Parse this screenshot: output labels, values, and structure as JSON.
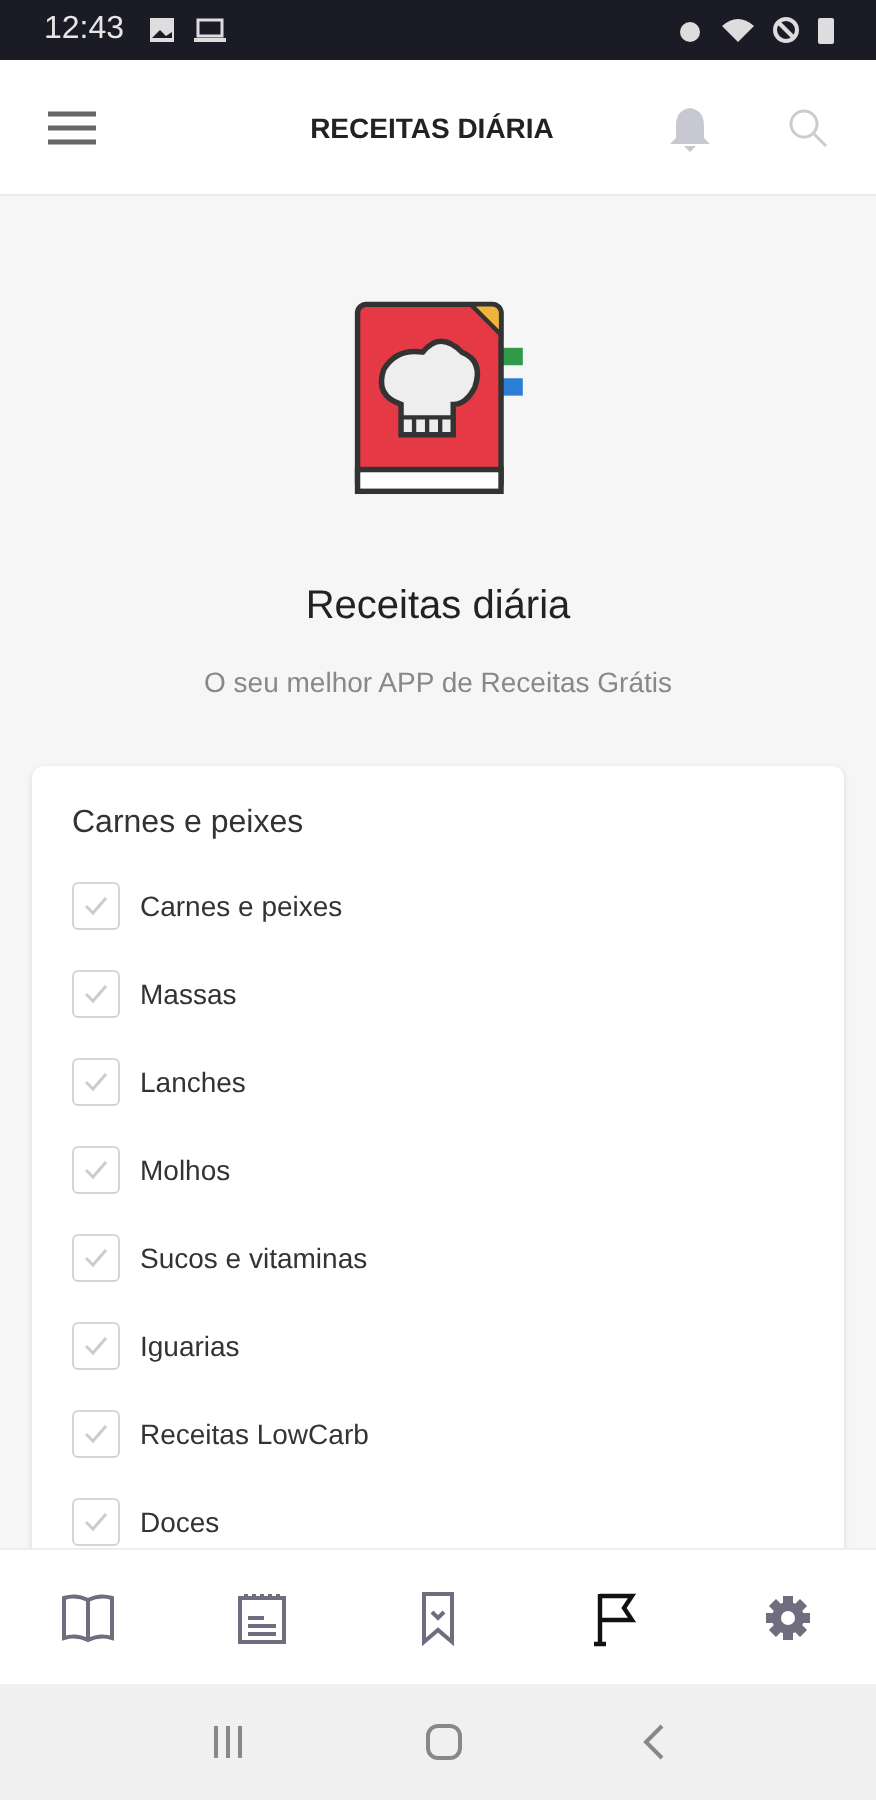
{
  "status_bar": {
    "time": "12:43"
  },
  "app_bar": {
    "title": "RECEITAS DIÁRIA"
  },
  "hero": {
    "title": "Receitas diária",
    "subtitle": "O seu melhor APP de Receitas Grátis"
  },
  "card": {
    "title": "Carnes e peixes",
    "items": [
      {
        "label": "Carnes e peixes",
        "checked": false
      },
      {
        "label": "Massas",
        "checked": false
      },
      {
        "label": "Lanches",
        "checked": false
      },
      {
        "label": "Molhos",
        "checked": false
      },
      {
        "label": "Sucos e vitaminas",
        "checked": false
      },
      {
        "label": "Iguarias",
        "checked": false
      },
      {
        "label": "Receitas LowCarb",
        "checked": false
      },
      {
        "label": "Doces",
        "checked": false
      }
    ]
  },
  "bottom_nav": [
    {
      "kind": "book",
      "selected": false
    },
    {
      "kind": "notepad",
      "selected": false
    },
    {
      "kind": "bookmark",
      "selected": false
    },
    {
      "kind": "flag",
      "selected": true
    },
    {
      "kind": "gear",
      "selected": false
    }
  ]
}
